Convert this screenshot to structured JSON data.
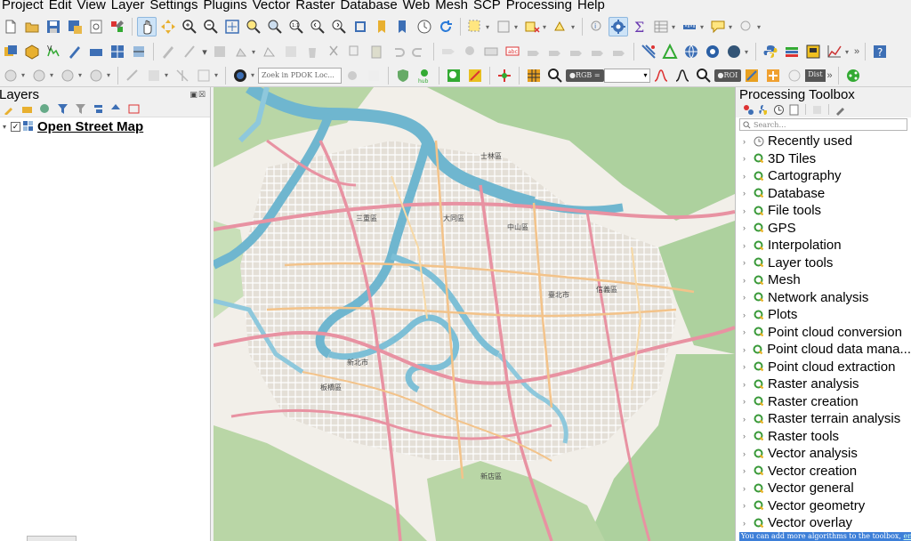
{
  "menubar": {
    "items": [
      "Project",
      "Edit",
      "View",
      "Layer",
      "Settings",
      "Plugins",
      "Vector",
      "Raster",
      "Database",
      "Web",
      "Mesh",
      "SCP",
      "Processing",
      "Help"
    ]
  },
  "toolbar": {
    "locator_placeholder": "Zoek in PDOK Loc...",
    "rgb_label": "RGB =",
    "roi_label": "ROI",
    "dist_label": "Dist",
    "hub_label": "hub"
  },
  "layers_panel": {
    "title": "Layers",
    "header_buttons": "▣☒",
    "layers": [
      {
        "name": "Open Street Map",
        "checked": true
      }
    ]
  },
  "toolbox": {
    "title": "Processing Toolbox",
    "search_placeholder": "Search…",
    "items": [
      {
        "label": "Recently used",
        "icon": "clock-icon"
      },
      {
        "label": "3D Tiles",
        "icon": "qgis-icon"
      },
      {
        "label": "Cartography",
        "icon": "qgis-icon"
      },
      {
        "label": "Database",
        "icon": "qgis-icon"
      },
      {
        "label": "File tools",
        "icon": "qgis-icon"
      },
      {
        "label": "GPS",
        "icon": "qgis-icon"
      },
      {
        "label": "Interpolation",
        "icon": "qgis-icon"
      },
      {
        "label": "Layer tools",
        "icon": "qgis-icon"
      },
      {
        "label": "Mesh",
        "icon": "qgis-icon"
      },
      {
        "label": "Network analysis",
        "icon": "qgis-icon"
      },
      {
        "label": "Plots",
        "icon": "qgis-icon"
      },
      {
        "label": "Point cloud conversion",
        "icon": "qgis-icon"
      },
      {
        "label": "Point cloud data mana...",
        "icon": "qgis-icon"
      },
      {
        "label": "Point cloud extraction",
        "icon": "qgis-icon"
      },
      {
        "label": "Raster analysis",
        "icon": "qgis-icon"
      },
      {
        "label": "Raster creation",
        "icon": "qgis-icon"
      },
      {
        "label": "Raster terrain analysis",
        "icon": "qgis-icon"
      },
      {
        "label": "Raster tools",
        "icon": "qgis-icon"
      },
      {
        "label": "Vector analysis",
        "icon": "qgis-icon"
      },
      {
        "label": "Vector creation",
        "icon": "qgis-icon"
      },
      {
        "label": "Vector general",
        "icon": "qgis-icon"
      },
      {
        "label": "Vector geometry",
        "icon": "qgis-icon"
      },
      {
        "label": "Vector overlay",
        "icon": "qgis-icon"
      }
    ],
    "footer_text": "You can add more algorithms to the toolbox, ",
    "footer_link": "enable additional providers."
  },
  "map": {
    "district_labels": [
      {
        "text": "臺北市"
      },
      {
        "text": "新北市"
      },
      {
        "text": "大同區"
      },
      {
        "text": "中山區"
      },
      {
        "text": "信義區"
      },
      {
        "text": "板橋區"
      },
      {
        "text": "三重區"
      },
      {
        "text": "新店區"
      },
      {
        "text": "士林區"
      }
    ],
    "colors": {
      "land": "#f2efe9",
      "urban": "#e0dcd6",
      "forest": "#add19e",
      "water": "#aad3df",
      "motorway": "#e892a2",
      "primary": "#fcd6a4"
    }
  }
}
